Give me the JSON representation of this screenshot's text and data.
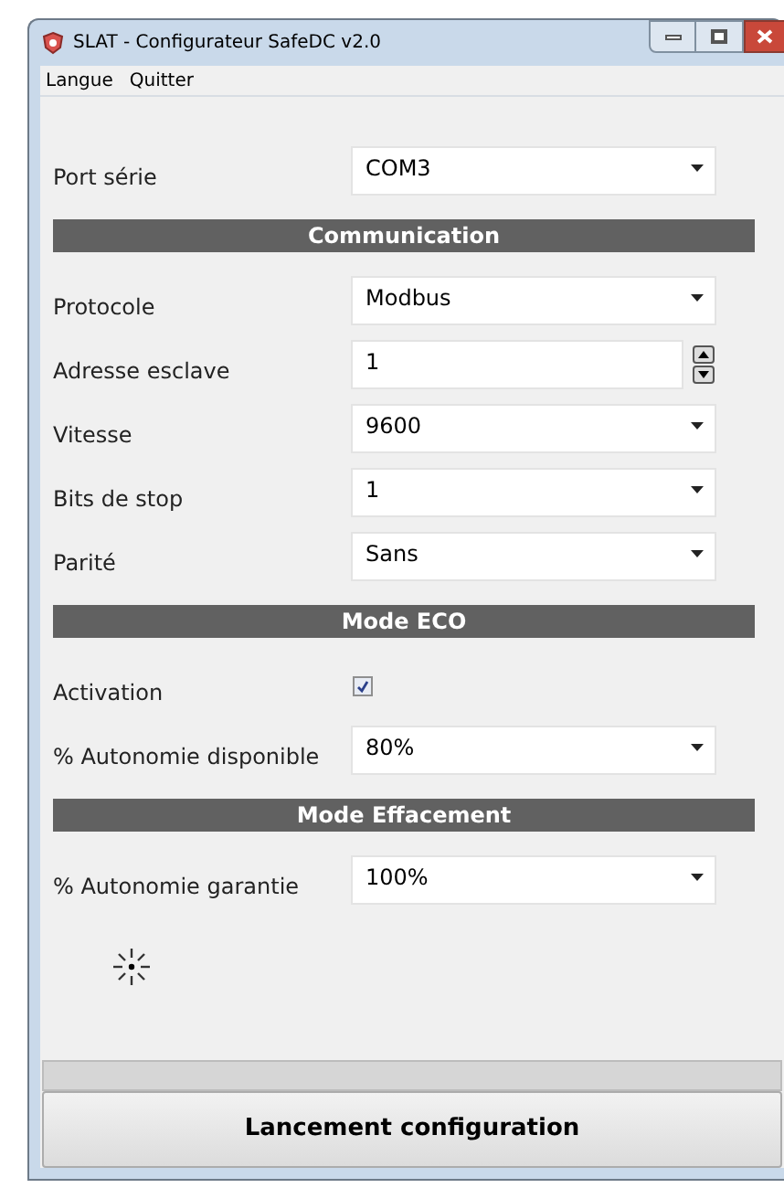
{
  "window": {
    "title": "SLAT - Configurateur SafeDC v2.0"
  },
  "menu": [
    "Langue",
    "Quitter"
  ],
  "rows": [
    {
      "kind": "dropdown",
      "label": "Port série",
      "value": "COM3"
    },
    {
      "kind": "header",
      "label": "Communication"
    },
    {
      "kind": "dropdown",
      "label": "Protocole",
      "value": "Modbus"
    },
    {
      "kind": "spinbox",
      "label": "Adresse esclave",
      "value": "1"
    },
    {
      "kind": "dropdown",
      "label": "Vitesse",
      "value": "9600"
    },
    {
      "kind": "dropdown",
      "label": "Bits de stop",
      "value": "1"
    },
    {
      "kind": "dropdown",
      "label": "Parité",
      "value": "Sans"
    },
    {
      "kind": "header",
      "label": "Mode ECO"
    },
    {
      "kind": "checkbox",
      "label": "Activation",
      "checked": true
    },
    {
      "kind": "dropdown",
      "label": "% Autonomie disponible",
      "value": "80%"
    },
    {
      "kind": "header",
      "label": "Mode Effacement"
    },
    {
      "kind": "dropdown",
      "label": "% Autonomie garantie",
      "value": "100%"
    }
  ],
  "progress": {
    "level": 0
  },
  "button": "Lancement configuration"
}
